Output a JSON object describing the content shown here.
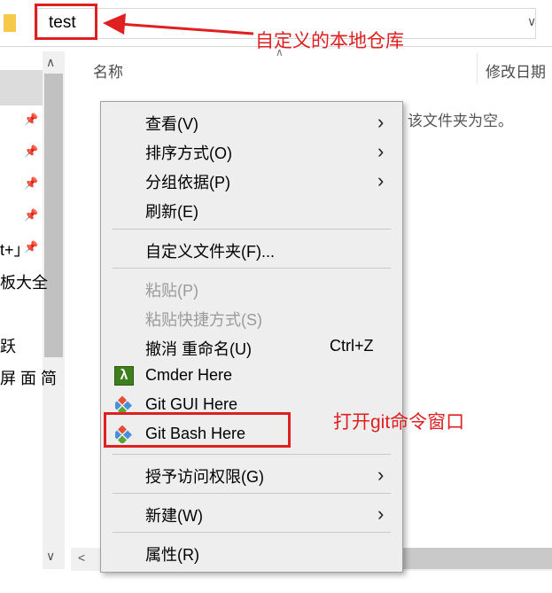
{
  "address_bar": {
    "path": "test",
    "dropdown_glyph": "∨"
  },
  "nav": {
    "up_glyph": "∧",
    "down_glyph": "∨",
    "pin_glyph": "📌",
    "items": [
      {
        "label": "",
        "pinned": true
      },
      {
        "label": "",
        "pinned": true
      },
      {
        "label": "",
        "pinned": true
      },
      {
        "label": "",
        "pinned": true
      },
      {
        "label": "t+」",
        "pinned": true
      },
      {
        "label": "板大全",
        "pinned": false
      },
      {
        "label": "跃",
        "pinned": false
      },
      {
        "label": "屏 面 简",
        "pinned": false
      }
    ]
  },
  "content": {
    "col_name": "名称",
    "col_date": "修改日期",
    "empty_text": "该文件夹为空。",
    "sort_glyph": "∧"
  },
  "hscroll": {
    "left_glyph": "<"
  },
  "context_menu": {
    "items": {
      "view": {
        "label": "查看(V)",
        "arrow": "›"
      },
      "sort": {
        "label": "排序方式(O)",
        "arrow": "›"
      },
      "group": {
        "label": "分组依据(P)",
        "arrow": "›"
      },
      "refresh": {
        "label": "刷新(E)"
      },
      "customize": {
        "label": "自定义文件夹(F)..."
      },
      "paste": {
        "label": "粘贴(P)",
        "disabled": true
      },
      "paste_shortcut": {
        "label": "粘贴快捷方式(S)",
        "disabled": true
      },
      "undo_rename": {
        "label": "撤消 重命名(U)",
        "shortcut": "Ctrl+Z"
      },
      "cmder": {
        "label": "Cmder Here",
        "icon": "lambda-icon",
        "icon_glyph": "λ",
        "icon_color": "#3f7e1c"
      },
      "git_gui": {
        "label": "Git GUI Here",
        "icon": "git-icon"
      },
      "git_bash": {
        "label": "Git Bash Here",
        "icon": "git-icon"
      },
      "grant_access": {
        "label": "授予访问权限(G)",
        "arrow": "›"
      },
      "new": {
        "label": "新建(W)",
        "arrow": "›"
      },
      "properties": {
        "label": "属性(R)"
      }
    }
  },
  "annotations": {
    "local_repo_text": "自定义的本地仓库",
    "git_window_text": "打开git命令窗口",
    "color": "#e02020"
  },
  "colors": {
    "menu_bg": "#eeeeee",
    "folder_yellow": "#f6c94b",
    "git_red": "#e84e31",
    "git_blue": "#4a90d9",
    "git_green": "#55a630"
  }
}
